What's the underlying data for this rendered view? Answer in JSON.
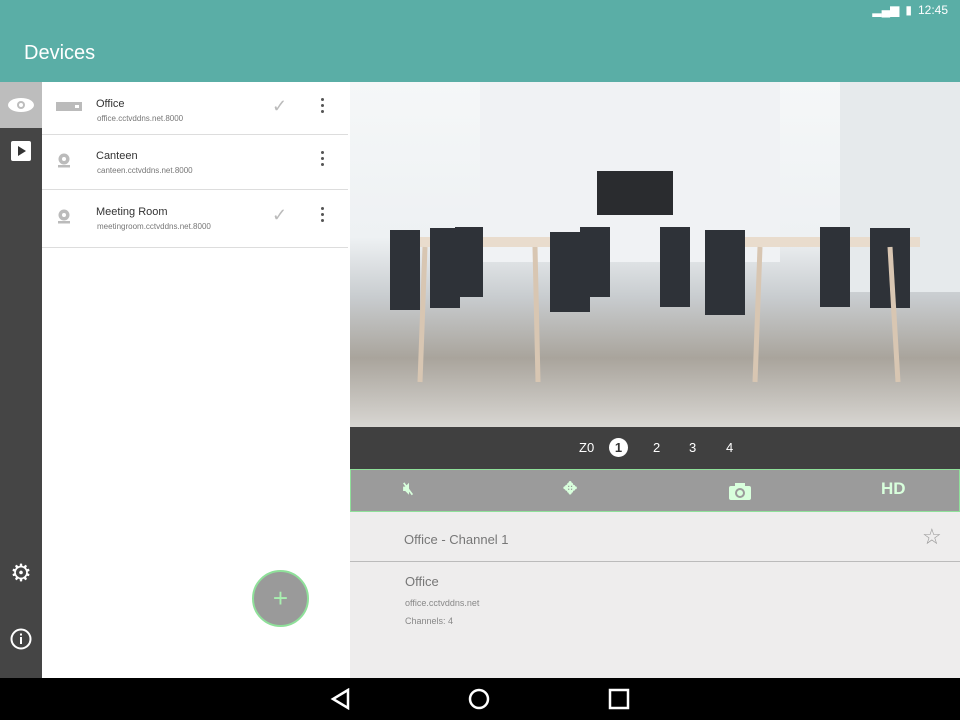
{
  "status": {
    "time": "12:45"
  },
  "app": {
    "title": "Devices"
  },
  "rail": [
    "eye-icon",
    "play-icon",
    "settings-icon",
    "info-icon"
  ],
  "devices": [
    {
      "name": "Office",
      "host": "office.cctvddns.net.8000",
      "checked": true,
      "type": "dvr"
    },
    {
      "name": "Canteen",
      "host": "canteen.cctvddns.net.8000",
      "checked": false,
      "type": "camera"
    },
    {
      "name": "Meeting Room",
      "host": "meetingroom.cctvddns.net.8000",
      "checked": true,
      "type": "camera"
    }
  ],
  "fab": "+",
  "channels": {
    "zoom": "Z0",
    "items": [
      "1",
      "2",
      "3",
      "4"
    ],
    "selected": "1"
  },
  "tools": {
    "hd": "HD"
  },
  "detail": {
    "channel_title": "Office - Channel 1",
    "device": "Office",
    "host": "office.cctvddns.net",
    "channels": "Channels: 4"
  }
}
